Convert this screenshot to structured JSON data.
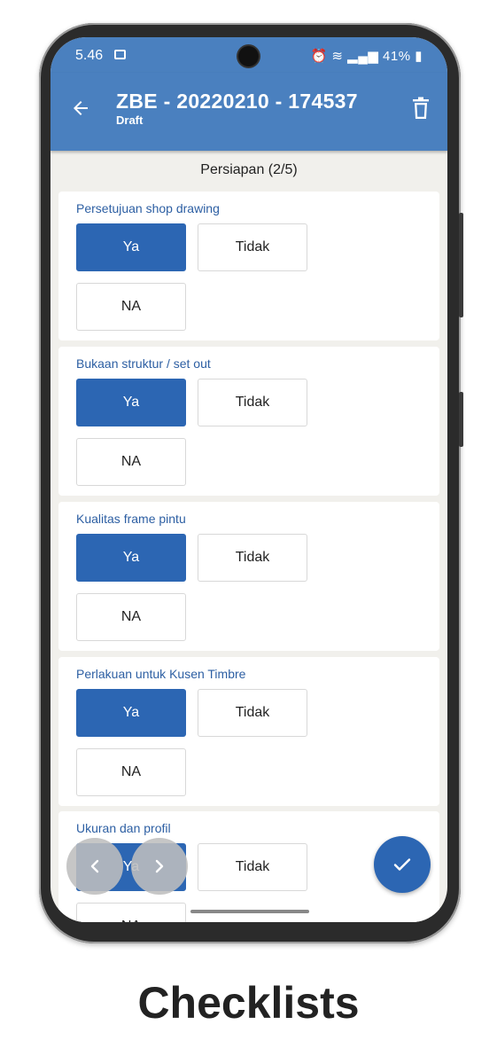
{
  "status_bar": {
    "time": "5.46",
    "battery": "41%"
  },
  "app_bar": {
    "title": "ZBE - 20220210 - 174537",
    "subtitle": "Draft"
  },
  "section": {
    "title": "Persiapan (2/5)"
  },
  "checklist": [
    {
      "label": "Persetujuan shop drawing",
      "options": [
        "Ya",
        "Tidak",
        "NA"
      ],
      "selected": "Ya"
    },
    {
      "label": "Bukaan struktur / set out",
      "options": [
        "Ya",
        "Tidak",
        "NA"
      ],
      "selected": "Ya"
    },
    {
      "label": "Kualitas frame pintu",
      "options": [
        "Ya",
        "Tidak",
        "NA"
      ],
      "selected": "Ya"
    },
    {
      "label": "Perlakuan untuk Kusen Timbre",
      "options": [
        "Ya",
        "Tidak",
        "NA"
      ],
      "selected": "Ya"
    },
    {
      "label": "Ukuran dan profil",
      "options": [
        "Ya",
        "Tidak",
        "NA"
      ],
      "selected": "Ya"
    }
  ],
  "colors": {
    "primary": "#4a80bf",
    "selected": "#2c66b3",
    "label": "#2d5fa3",
    "background": "#f1f0ec"
  },
  "icons": {
    "back": "arrow-left-icon",
    "delete": "trash-icon",
    "prev": "chevron-left-icon",
    "next": "chevron-right-icon",
    "submit": "check-icon"
  },
  "caption": "Checklists"
}
